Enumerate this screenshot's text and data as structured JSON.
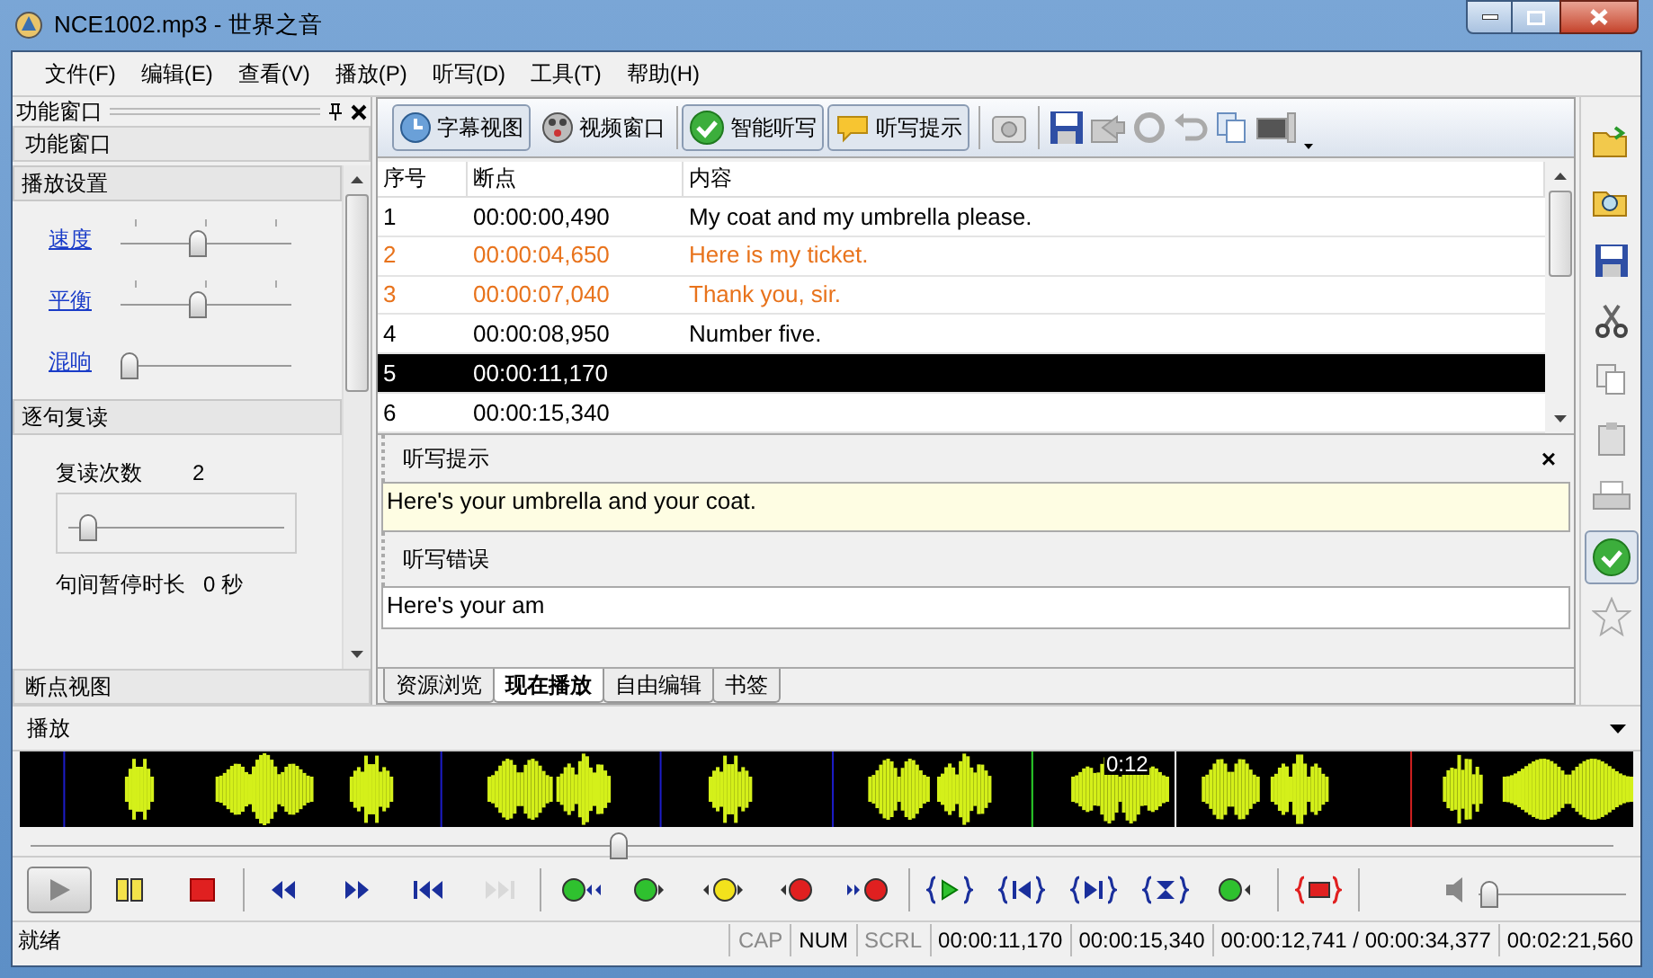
{
  "window": {
    "title": "NCE1002.mp3 - 世界之音"
  },
  "menu": [
    "文件(F)",
    "编辑(E)",
    "查看(V)",
    "播放(P)",
    "听写(D)",
    "工具(T)",
    "帮助(H)"
  ],
  "left_panel": {
    "title": "功能窗口",
    "subtitle": "功能窗口",
    "play_settings": {
      "title": "播放设置",
      "sliders": [
        {
          "label": "速度",
          "level": 0.45,
          "ticks": true
        },
        {
          "label": "平衡",
          "level": 0.45,
          "ticks": true
        },
        {
          "label": "混响",
          "level": 0.0,
          "ticks": false
        }
      ]
    },
    "repeat": {
      "title": "逐句复读",
      "count_label": "复读次数",
      "count_value": "2",
      "level": 0.05,
      "pause_label": "句间暂停时长",
      "pause_value": "0 秒"
    },
    "footer": "断点视图"
  },
  "toolbar": [
    {
      "label": "字幕视图",
      "kind": "subtitle",
      "selected": true
    },
    {
      "label": "视频窗口",
      "kind": "video",
      "selected": false
    },
    {
      "label": "智能听写",
      "kind": "check",
      "selected": true
    },
    {
      "label": "听写提示",
      "kind": "bubble",
      "selected": true
    }
  ],
  "table": {
    "columns": [
      "序号",
      "断点",
      "内容"
    ],
    "rows": [
      {
        "cells": [
          "1",
          "00:00:00,490",
          "My coat and my umbrella please."
        ],
        "color": "#000000",
        "selected": false
      },
      {
        "cells": [
          "2",
          "00:00:04,650",
          "Here is my ticket."
        ],
        "color": "#e8731c",
        "selected": false
      },
      {
        "cells": [
          "3",
          "00:00:07,040",
          "Thank you, sir."
        ],
        "color": "#e8731c",
        "selected": false
      },
      {
        "cells": [
          "4",
          "00:00:08,950",
          "Number five."
        ],
        "color": "#000000",
        "selected": false
      },
      {
        "cells": [
          "5",
          "00:00:11,170",
          ""
        ],
        "selected": true
      },
      {
        "cells": [
          "6",
          "00:00:15,340",
          ""
        ],
        "color": "#000000",
        "selected": false
      }
    ]
  },
  "hint_panel": {
    "title": "听写提示",
    "close": "×",
    "text": "Here's your umbrella and your coat."
  },
  "error_panel": {
    "title": "听写错误",
    "text": "Here's your am"
  },
  "tabs": [
    {
      "label": "资源浏览",
      "selected": false
    },
    {
      "label": "现在播放",
      "selected": true
    },
    {
      "label": "自由编辑",
      "selected": false
    },
    {
      "label": "书签",
      "selected": false
    }
  ],
  "right_toolbar": [
    {
      "kind": "open",
      "selected": false
    },
    {
      "kind": "search",
      "selected": false
    },
    {
      "kind": "save",
      "selected": false
    },
    {
      "kind": "cut",
      "selected": false
    },
    {
      "kind": "copy",
      "selected": false
    },
    {
      "kind": "paste",
      "selected": false
    },
    {
      "kind": "print",
      "selected": false
    },
    {
      "kind": "check",
      "selected": true
    },
    {
      "kind": "star",
      "selected": false
    }
  ],
  "play_panel": {
    "title": "播放",
    "time_label": "0:12",
    "seek": {
      "level": 0.37
    }
  },
  "transport": [
    [
      {
        "kind": "play",
        "selected": true,
        "disabled": false
      },
      {
        "kind": "pause",
        "selected": false,
        "disabled": false
      },
      {
        "kind": "stop",
        "selected": false,
        "disabled": false
      }
    ],
    [
      {
        "kind": "rewind",
        "selected": false,
        "disabled": false
      },
      {
        "kind": "forward",
        "selected": false,
        "disabled": false
      },
      {
        "kind": "prev",
        "selected": false,
        "disabled": false
      },
      {
        "kind": "next",
        "selected": false,
        "disabled": true
      }
    ],
    [
      {
        "kind": "green-back",
        "selected": false,
        "disabled": false
      },
      {
        "kind": "green-play",
        "selected": false,
        "disabled": false
      },
      {
        "kind": "yellow-ab",
        "selected": false,
        "disabled": false
      },
      {
        "kind": "red-left",
        "selected": false,
        "disabled": false
      },
      {
        "kind": "red-right",
        "selected": false,
        "disabled": false
      }
    ],
    [
      {
        "kind": "brace-play",
        "selected": false,
        "disabled": false
      },
      {
        "kind": "brace-prev",
        "selected": false,
        "disabled": false
      },
      {
        "kind": "brace-next",
        "selected": false,
        "disabled": false
      },
      {
        "kind": "brace-loop",
        "selected": false,
        "disabled": false
      },
      {
        "kind": "green-left",
        "selected": false,
        "disabled": false
      }
    ],
    [
      {
        "kind": "brace-record",
        "selected": false,
        "disabled": false
      }
    ]
  ],
  "volume": {
    "level": 0.02
  },
  "status_bar": {
    "message": "就绪",
    "indicators": [
      {
        "label": "CAP",
        "on": false
      },
      {
        "label": "NUM",
        "on": true
      },
      {
        "label": "SCRL",
        "on": false
      }
    ],
    "fields": [
      "00:00:11,170",
      "00:00:15,340",
      "00:00:12,741 / 00:00:34,377",
      "00:02:21,560"
    ]
  }
}
